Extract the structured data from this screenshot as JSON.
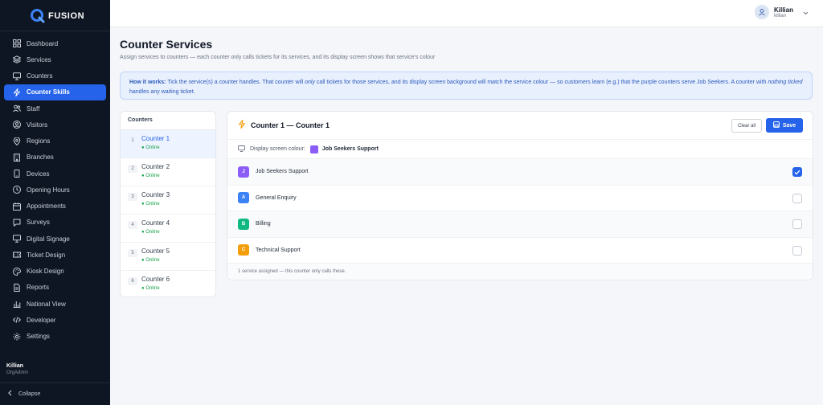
{
  "sidebar": {
    "brand": "FUSION",
    "items": [
      {
        "label": "Dashboard",
        "icon": "grid-icon"
      },
      {
        "label": "Services",
        "icon": "layers-icon"
      },
      {
        "label": "Counters",
        "icon": "monitor-icon"
      },
      {
        "label": "Counter Skills",
        "icon": "lightning-icon",
        "active": true
      },
      {
        "label": "Staff",
        "icon": "users-icon"
      },
      {
        "label": "Visitors",
        "icon": "user-circle-icon"
      },
      {
        "label": "Regions",
        "icon": "map-pin-icon"
      },
      {
        "label": "Branches",
        "icon": "building-icon"
      },
      {
        "label": "Devices",
        "icon": "tablet-icon"
      },
      {
        "label": "Opening Hours",
        "icon": "clock-icon"
      },
      {
        "label": "Appointments",
        "icon": "calendar-icon"
      },
      {
        "label": "Surveys",
        "icon": "chat-icon"
      },
      {
        "label": "Digital Signage",
        "icon": "monitor-icon"
      },
      {
        "label": "Ticket Design",
        "icon": "ticket-icon"
      },
      {
        "label": "Kiosk Design",
        "icon": "palette-icon"
      },
      {
        "label": "Reports",
        "icon": "file-icon"
      },
      {
        "label": "National View",
        "icon": "bar-chart-icon"
      },
      {
        "label": "Developer",
        "icon": "code-icon"
      },
      {
        "label": "Settings",
        "icon": "gear-icon"
      }
    ],
    "user": {
      "name": "Killian",
      "role": "OrgAdmin"
    },
    "collapse_label": "Collapse"
  },
  "topbar": {
    "user_name": "Killian",
    "user_handle": "killian"
  },
  "page": {
    "title": "Counter Services",
    "subtitle": "Assign services to counters — each counter only calls tickets for its services, and its display screen shows that service's colour"
  },
  "info": {
    "lead": "How it works:",
    "t1": " Tick the service(s) a counter handles. That counter will ",
    "em1": "only",
    "t2": " call tickets for those services, and its display screen background will match the service colour — so customers learn (e.g.) that the purple counters serve Job Seekers. A counter with ",
    "em2": "nothing ticked",
    "t3": " handles any waiting ticket."
  },
  "counters": {
    "heading": "Counters",
    "items": [
      {
        "num": "1",
        "name": "Counter 1",
        "status": "● Online",
        "active": true
      },
      {
        "num": "2",
        "name": "Counter 2",
        "status": "● Online"
      },
      {
        "num": "3",
        "name": "Counter 3",
        "status": "● Online"
      },
      {
        "num": "4",
        "name": "Counter 4",
        "status": "● Online"
      },
      {
        "num": "5",
        "name": "Counter 5",
        "status": "● Online"
      },
      {
        "num": "6",
        "name": "Counter 6",
        "status": "● Online"
      }
    ]
  },
  "detail": {
    "title": "Counter 1 — Counter 1",
    "clear_label": "Clear all",
    "save_label": "Save",
    "display_label": "Display screen colour:",
    "display_service": "Job Seekers Support",
    "display_color": "#8b5cf6",
    "services": [
      {
        "letter": "J",
        "name": "Job Seekers Support",
        "color": "#8b5cf6",
        "checked": true
      },
      {
        "letter": "A",
        "name": "General Enquiry",
        "color": "#3b82f6",
        "checked": false
      },
      {
        "letter": "B",
        "name": "Billing",
        "color": "#10b981",
        "checked": false
      },
      {
        "letter": "C",
        "name": "Technical Support",
        "color": "#f59e0b",
        "checked": false
      }
    ],
    "footer": "1 service assigned — this counter only calls these."
  }
}
